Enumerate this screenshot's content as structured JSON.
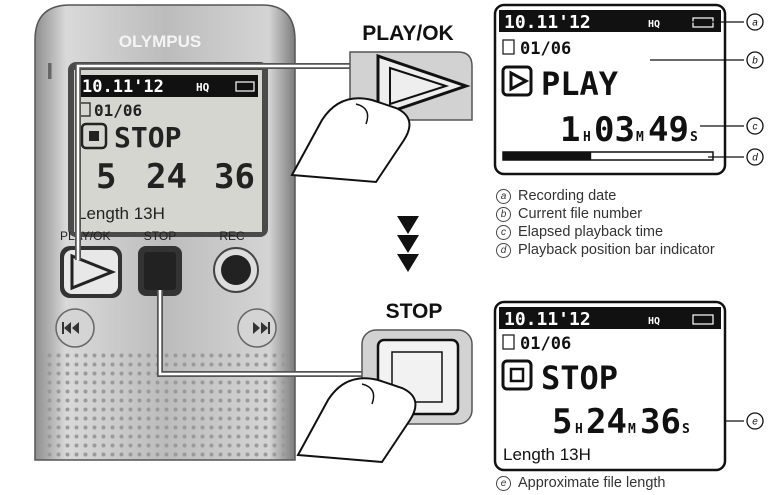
{
  "device": {
    "brand": "OLYMPUS",
    "screen": {
      "date": "10.11'12",
      "quality": "HQ",
      "file_number": "01/06",
      "status": "STOP",
      "time": {
        "h": "5",
        "m": "24",
        "s": "36"
      },
      "length_text": "Length 13H"
    },
    "buttons": {
      "play_ok": "PLAY/OK",
      "stop": "STOP",
      "rec": "REC"
    }
  },
  "callouts": {
    "play_ok": "PLAY/OK",
    "stop": "STOP"
  },
  "screen_play": {
    "date": "10.11'12",
    "quality": "HQ",
    "file_number": "01/06",
    "status": "PLAY",
    "time": {
      "h": "1",
      "m": "03",
      "s": "49"
    },
    "unit_h": "H",
    "unit_m": "M",
    "unit_s": "S",
    "progress": 0.42
  },
  "screen_stop": {
    "date": "10.11'12",
    "quality": "HQ",
    "file_number": "01/06",
    "status": "STOP",
    "time": {
      "h": "5",
      "m": "24",
      "s": "36"
    },
    "unit_h": "H",
    "unit_m": "M",
    "unit_s": "S",
    "length_text": "Length 13H"
  },
  "legend": {
    "items": [
      {
        "marker": "a",
        "text": "Recording date"
      },
      {
        "marker": "b",
        "text": "Current file number"
      },
      {
        "marker": "c",
        "text": "Elapsed playback time"
      },
      {
        "marker": "d",
        "text": "Playback position bar indicator"
      }
    ],
    "item_e": {
      "marker": "e",
      "text": "Approximate file length"
    }
  },
  "colors": {
    "accent": "#000000",
    "device_body": "#c9c9c9",
    "lcd": "#d6d6d0"
  }
}
